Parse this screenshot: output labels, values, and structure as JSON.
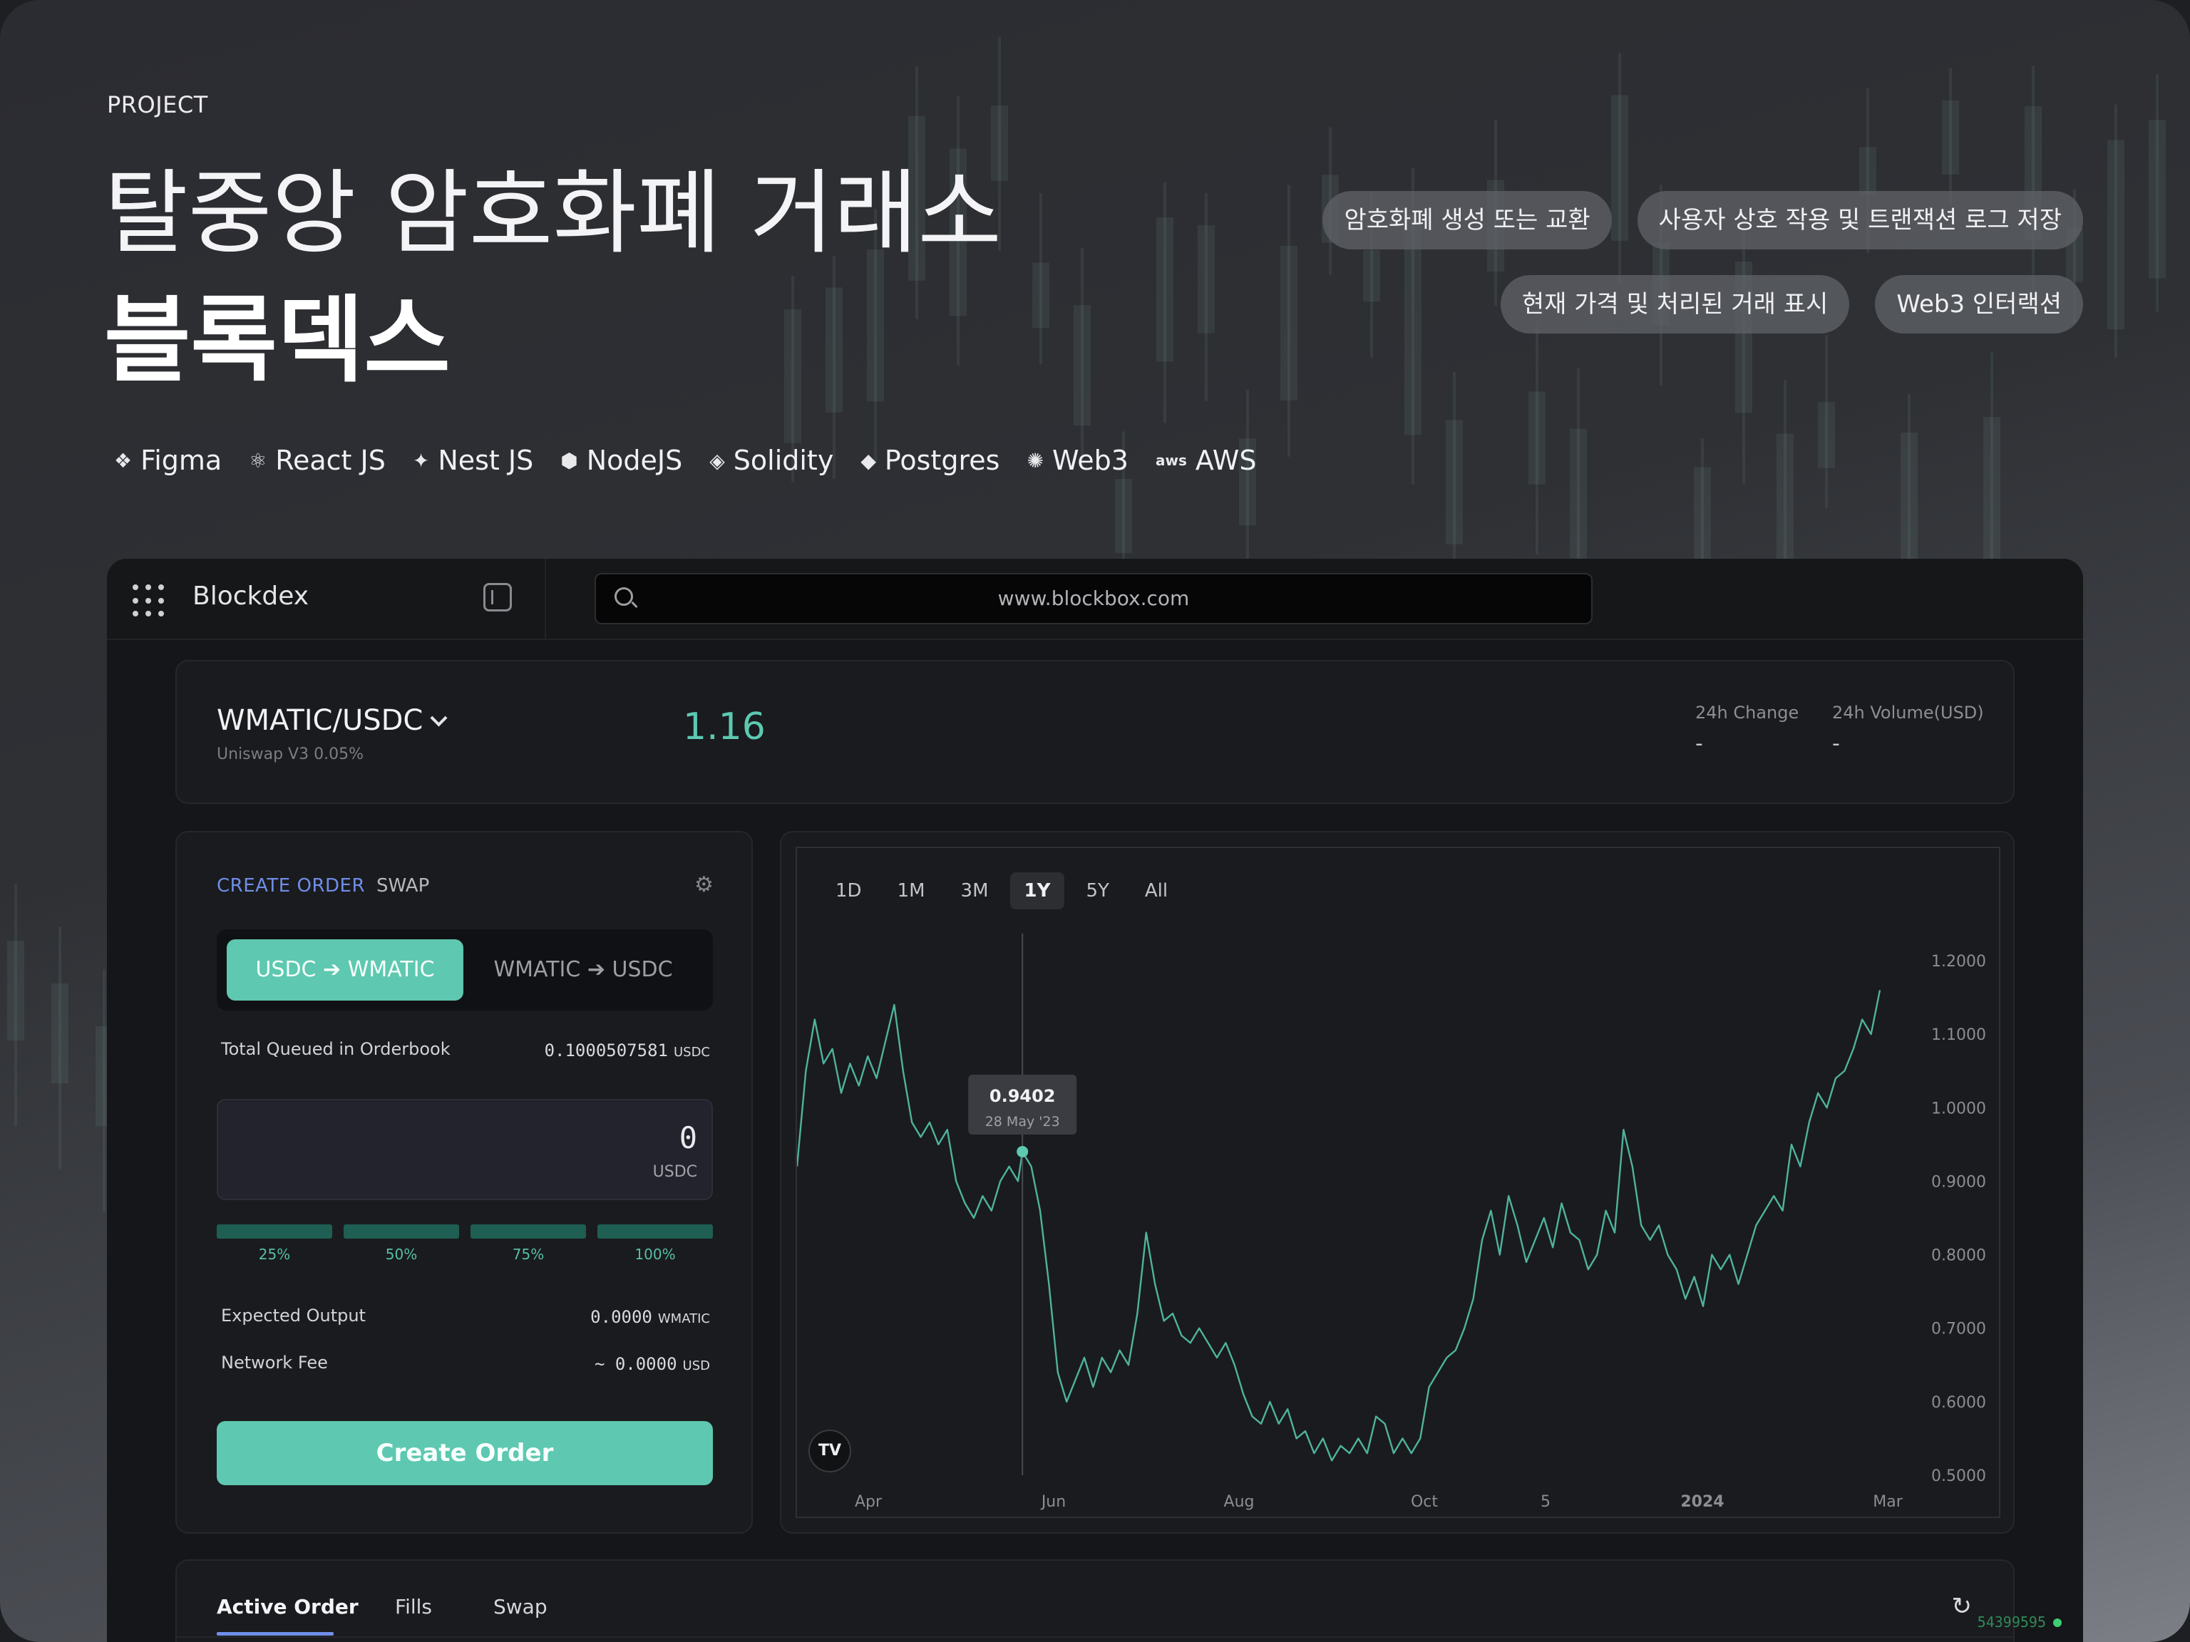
{
  "hero": {
    "eyebrow": "PROJECT",
    "title_line1": "탈중앙 암호화폐 거래소",
    "title_line2": "블록덱스",
    "feature_tags": [
      "암호화폐 생성 또는 교환",
      "사용자 상호 작용 및 트랜잭션 로그 저장",
      "현재 가격 및 처리된 거래 표시",
      "Web3 인터랙션"
    ],
    "tech_stack": [
      {
        "name": "Figma",
        "icon": "figma-icon"
      },
      {
        "name": "React JS",
        "icon": "react-icon"
      },
      {
        "name": "Nest JS",
        "icon": "nestjs-icon"
      },
      {
        "name": "NodeJS",
        "icon": "nodejs-icon"
      },
      {
        "name": "Solidity",
        "icon": "solidity-icon"
      },
      {
        "name": "Postgres",
        "icon": "postgres-icon"
      },
      {
        "name": "Web3",
        "icon": "web3-icon"
      },
      {
        "name": "AWS",
        "icon": "aws-icon"
      }
    ]
  },
  "app": {
    "name": "Blockdex",
    "url": "www.blockbox.com"
  },
  "pair": {
    "name": "WMATIC/USDC",
    "pool": "Uniswap V3 0.05%",
    "price": "1.16",
    "change_label": "24h Change",
    "change_value": "-",
    "volume_label": "24h Volume(USD)",
    "volume_value": "-"
  },
  "order": {
    "tab_create": "CREATE ORDER",
    "tab_swap": "SWAP",
    "dir_active": "USDC ➔ WMATIC",
    "dir_inactive": "WMATIC ➔ USDC",
    "queued_label": "Total Queued in Orderbook",
    "queued_value": "0.1000507581",
    "queued_unit": "USDC",
    "amount": "0",
    "amount_unit": "USDC",
    "pct_options": [
      "25%",
      "50%",
      "75%",
      "100%"
    ],
    "expected_label": "Expected Output",
    "expected_value": "0.0000",
    "expected_unit": "WMATIC",
    "fee_label": "Network Fee",
    "fee_value": "~ 0.0000",
    "fee_unit": "USD",
    "submit_label": "Create Order"
  },
  "orders_panel": {
    "tabs": [
      "Active Order",
      "Fills",
      "Swap"
    ],
    "block_number": "54399595"
  },
  "chart_data": {
    "type": "line",
    "ranges": [
      "1D",
      "1M",
      "3M",
      "1Y",
      "5Y",
      "All"
    ],
    "active_range": "1Y",
    "x_labels": [
      "Apr",
      "Jun",
      "Aug",
      "Oct",
      "5",
      "2024",
      "Mar"
    ],
    "y_ticks": [
      "1.2000",
      "1.1000",
      "1.0000",
      "0.9000",
      "0.8000",
      "0.7000",
      "0.6000",
      "0.5000"
    ],
    "ylim": [
      0.5,
      1.2
    ],
    "color": "#4fb39d",
    "tooltip": {
      "value": "0.9402",
      "date": "28 May '23"
    },
    "points": [
      [
        0.0,
        0.92
      ],
      [
        0.008,
        1.05
      ],
      [
        0.016,
        1.12
      ],
      [
        0.024,
        1.06
      ],
      [
        0.032,
        1.08
      ],
      [
        0.04,
        1.02
      ],
      [
        0.048,
        1.06
      ],
      [
        0.056,
        1.03
      ],
      [
        0.064,
        1.07
      ],
      [
        0.072,
        1.04
      ],
      [
        0.08,
        1.09
      ],
      [
        0.088,
        1.14
      ],
      [
        0.096,
        1.05
      ],
      [
        0.104,
        0.98
      ],
      [
        0.112,
        0.96
      ],
      [
        0.12,
        0.98
      ],
      [
        0.128,
        0.95
      ],
      [
        0.136,
        0.97
      ],
      [
        0.144,
        0.9
      ],
      [
        0.152,
        0.87
      ],
      [
        0.16,
        0.85
      ],
      [
        0.168,
        0.88
      ],
      [
        0.176,
        0.86
      ],
      [
        0.184,
        0.9
      ],
      [
        0.192,
        0.92
      ],
      [
        0.2,
        0.9
      ],
      [
        0.204,
        0.94
      ],
      [
        0.212,
        0.92
      ],
      [
        0.22,
        0.86
      ],
      [
        0.228,
        0.76
      ],
      [
        0.236,
        0.64
      ],
      [
        0.244,
        0.6
      ],
      [
        0.252,
        0.63
      ],
      [
        0.26,
        0.66
      ],
      [
        0.268,
        0.62
      ],
      [
        0.276,
        0.66
      ],
      [
        0.284,
        0.64
      ],
      [
        0.292,
        0.67
      ],
      [
        0.3,
        0.65
      ],
      [
        0.308,
        0.72
      ],
      [
        0.316,
        0.83
      ],
      [
        0.324,
        0.76
      ],
      [
        0.332,
        0.71
      ],
      [
        0.34,
        0.72
      ],
      [
        0.348,
        0.69
      ],
      [
        0.356,
        0.68
      ],
      [
        0.364,
        0.7
      ],
      [
        0.372,
        0.68
      ],
      [
        0.38,
        0.66
      ],
      [
        0.388,
        0.68
      ],
      [
        0.396,
        0.65
      ],
      [
        0.404,
        0.61
      ],
      [
        0.412,
        0.58
      ],
      [
        0.42,
        0.57
      ],
      [
        0.428,
        0.6
      ],
      [
        0.436,
        0.57
      ],
      [
        0.444,
        0.59
      ],
      [
        0.452,
        0.55
      ],
      [
        0.46,
        0.56
      ],
      [
        0.468,
        0.53
      ],
      [
        0.476,
        0.55
      ],
      [
        0.484,
        0.52
      ],
      [
        0.492,
        0.54
      ],
      [
        0.5,
        0.53
      ],
      [
        0.508,
        0.55
      ],
      [
        0.516,
        0.53
      ],
      [
        0.524,
        0.58
      ],
      [
        0.532,
        0.57
      ],
      [
        0.54,
        0.53
      ],
      [
        0.548,
        0.55
      ],
      [
        0.556,
        0.53
      ],
      [
        0.564,
        0.55
      ],
      [
        0.572,
        0.62
      ],
      [
        0.58,
        0.64
      ],
      [
        0.588,
        0.66
      ],
      [
        0.596,
        0.67
      ],
      [
        0.604,
        0.7
      ],
      [
        0.612,
        0.74
      ],
      [
        0.62,
        0.82
      ],
      [
        0.628,
        0.86
      ],
      [
        0.636,
        0.8
      ],
      [
        0.644,
        0.88
      ],
      [
        0.652,
        0.84
      ],
      [
        0.66,
        0.79
      ],
      [
        0.668,
        0.82
      ],
      [
        0.676,
        0.85
      ],
      [
        0.684,
        0.81
      ],
      [
        0.692,
        0.87
      ],
      [
        0.7,
        0.83
      ],
      [
        0.708,
        0.82
      ],
      [
        0.716,
        0.78
      ],
      [
        0.724,
        0.8
      ],
      [
        0.732,
        0.86
      ],
      [
        0.74,
        0.83
      ],
      [
        0.748,
        0.97
      ],
      [
        0.756,
        0.92
      ],
      [
        0.764,
        0.84
      ],
      [
        0.772,
        0.82
      ],
      [
        0.78,
        0.84
      ],
      [
        0.788,
        0.8
      ],
      [
        0.796,
        0.78
      ],
      [
        0.804,
        0.74
      ],
      [
        0.812,
        0.77
      ],
      [
        0.82,
        0.73
      ],
      [
        0.828,
        0.8
      ],
      [
        0.836,
        0.78
      ],
      [
        0.844,
        0.8
      ],
      [
        0.852,
        0.76
      ],
      [
        0.86,
        0.8
      ],
      [
        0.868,
        0.84
      ],
      [
        0.876,
        0.86
      ],
      [
        0.884,
        0.88
      ],
      [
        0.892,
        0.86
      ],
      [
        0.9,
        0.95
      ],
      [
        0.908,
        0.92
      ],
      [
        0.916,
        0.98
      ],
      [
        0.924,
        1.02
      ],
      [
        0.932,
        1.0
      ],
      [
        0.94,
        1.04
      ],
      [
        0.948,
        1.05
      ],
      [
        0.956,
        1.08
      ],
      [
        0.964,
        1.12
      ],
      [
        0.972,
        1.1
      ],
      [
        0.98,
        1.16
      ]
    ]
  }
}
